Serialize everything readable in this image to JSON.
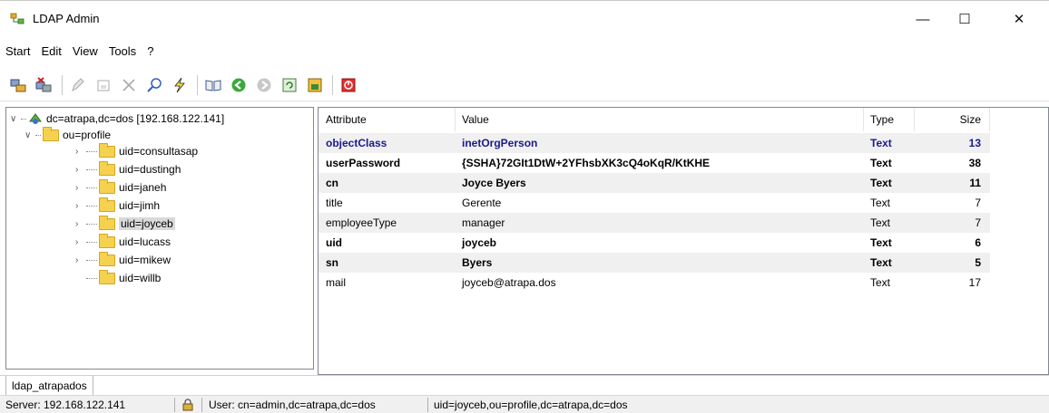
{
  "window": {
    "title": "LDAP Admin",
    "minimize": "—",
    "maximize": "☐",
    "close": "✕"
  },
  "menu": [
    "Start",
    "Edit",
    "View",
    "Tools",
    "?"
  ],
  "tree": {
    "root": "dc=atrapa,dc=dos [192.168.122.141]",
    "ou": "ou=profile",
    "items": [
      "uid=consultasap",
      "uid=dustingh",
      "uid=janeh",
      "uid=jimh",
      "uid=joyceb",
      "uid=lucass",
      "uid=mikew",
      "uid=willb"
    ],
    "selected": "uid=joyceb"
  },
  "table": {
    "headers": {
      "attribute": "Attribute",
      "value": "Value",
      "type": "Type",
      "size": "Size"
    },
    "rows": [
      {
        "attribute": "objectClass",
        "value": "inetOrgPerson",
        "type": "Text",
        "size": "13"
      },
      {
        "attribute": "userPassword",
        "value": "{SSHA}72GIt1DtW+2YFhsbXK3cQ4oKqR/KtKHE",
        "type": "Text",
        "size": "38"
      },
      {
        "attribute": "cn",
        "value": "Joyce Byers",
        "type": "Text",
        "size": "11"
      },
      {
        "attribute": "title",
        "value": "Gerente",
        "type": "Text",
        "size": "7"
      },
      {
        "attribute": "employeeType",
        "value": "manager",
        "type": "Text",
        "size": "7"
      },
      {
        "attribute": "uid",
        "value": "joyceb",
        "type": "Text",
        "size": "6"
      },
      {
        "attribute": "sn",
        "value": "Byers",
        "type": "Text",
        "size": "5"
      },
      {
        "attribute": "mail",
        "value": "joyceb@atrapa.dos",
        "type": "Text",
        "size": "17"
      }
    ]
  },
  "tabs": [
    "ldap_atrapados"
  ],
  "status": {
    "server": "Server: 192.168.122.141",
    "user": "User: cn=admin,dc=atrapa,dc=dos",
    "dn": "uid=joyceb,ou=profile,dc=atrapa,dc=dos"
  },
  "colors": {
    "accent": "#1a1a8c",
    "folder": "#f4d24f",
    "alt_row": "#f0f0f0"
  },
  "icons": [
    "connect-icon",
    "disconnect-icon",
    "edit-icon",
    "save-icon",
    "delete-icon",
    "search-icon",
    "flash-icon",
    "book-icon",
    "back-icon",
    "forward-icon",
    "refresh-icon",
    "schema-icon",
    "close-icon",
    "lock-icon",
    "folder-icon"
  ]
}
